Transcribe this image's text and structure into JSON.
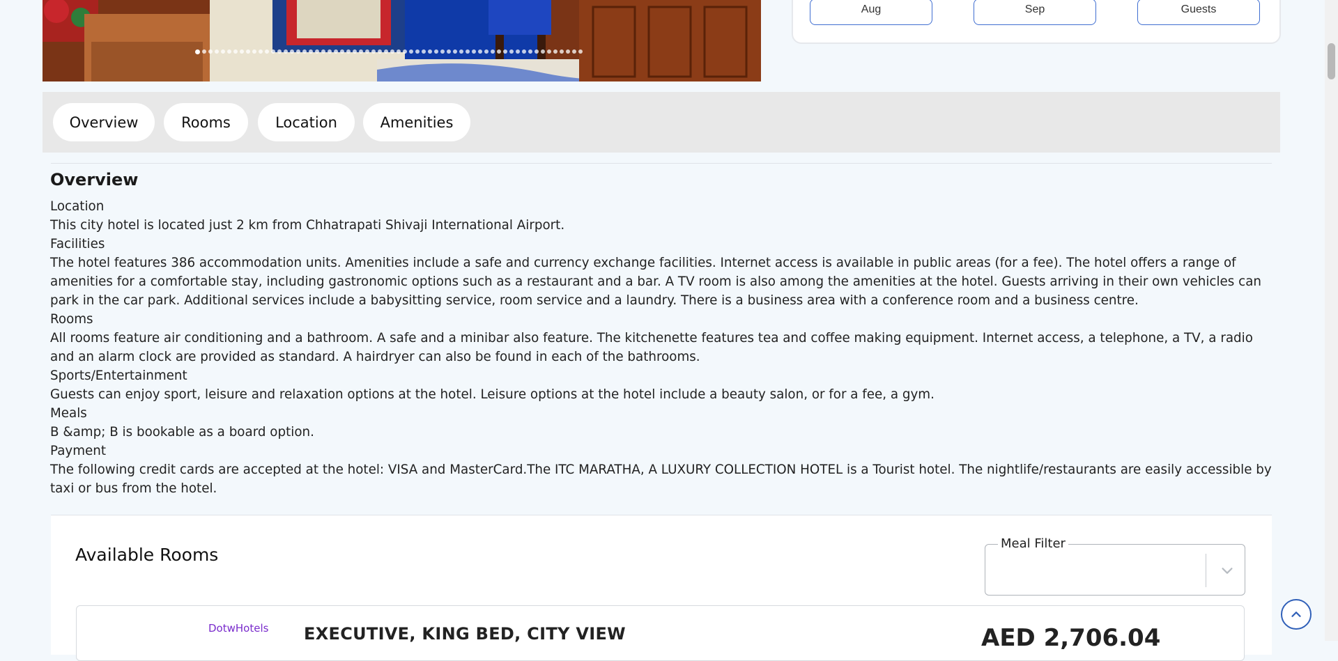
{
  "gallery": {
    "alt": "Hotel room photo",
    "slide_count": 62,
    "active_slide": 1
  },
  "booking": {
    "checkin_label": "Aug",
    "checkout_label": "Sep",
    "guests_label": "Guests"
  },
  "tabs": [
    {
      "label": "Overview"
    },
    {
      "label": "Rooms"
    },
    {
      "label": "Location"
    },
    {
      "label": "Amenities"
    }
  ],
  "overview": {
    "title": "Overview",
    "paragraphs": [
      "Location",
      "This city hotel is located just 2 km from Chhatrapati Shivaji International Airport.",
      "Facilities",
      "The hotel features 386 accommodation units. Amenities include a safe and currency exchange facilities. Internet access is available in public areas (for a fee). The hotel offers a range of amenities for a comfortable stay, including gastronomic options such as a restaurant and a bar. A TV room is also among the amenities at the hotel. Guests arriving in their own vehicles can park in the car park. Additional services include a babysitting service, room service and a laundry. There is a business area with a conference room and a business centre.",
      "Rooms",
      "All rooms feature air conditioning and a bathroom. A safe and a minibar also feature. The kitchenette features tea and coffee making equipment. Internet access, a telephone, a TV, a radio and an alarm clock are provided as standard. A hairdryer can also be found in each of the bathrooms.",
      "Sports/Entertainment",
      "Guests can enjoy sport, leisure and relaxation options at the hotel. Leisure options at the hotel include a beauty salon, or for a fee, a gym.",
      "Meals",
      "B &amp; B is bookable as a board option.",
      "Payment",
      "The following credit cards are accepted at the hotel: VISA and MasterCard.The ITC MARATHA, A LUXURY COLLECTION HOTEL is a Tourist hotel. The nightlife/restaurants are easily accessible by taxi or bus from the hotel."
    ]
  },
  "available_rooms": {
    "title": "Available Rooms",
    "meal_filter_label": "Meal Filter",
    "meal_filter_value": "",
    "rooms": [
      {
        "supplier": "DotwHotels",
        "name": "EXECUTIVE, KING BED, CITY VIEW",
        "price": "AED 2,706.04"
      }
    ]
  },
  "colors": {
    "page_bg": "#f3f8fc",
    "tabbar_bg": "#e8e8e8",
    "accent_blue": "#3f6ed1",
    "supplier_purple": "#7a2ccc"
  },
  "icons": {
    "meal_filter": "chevron-down-icon",
    "scroll_top": "chevron-up-icon"
  }
}
